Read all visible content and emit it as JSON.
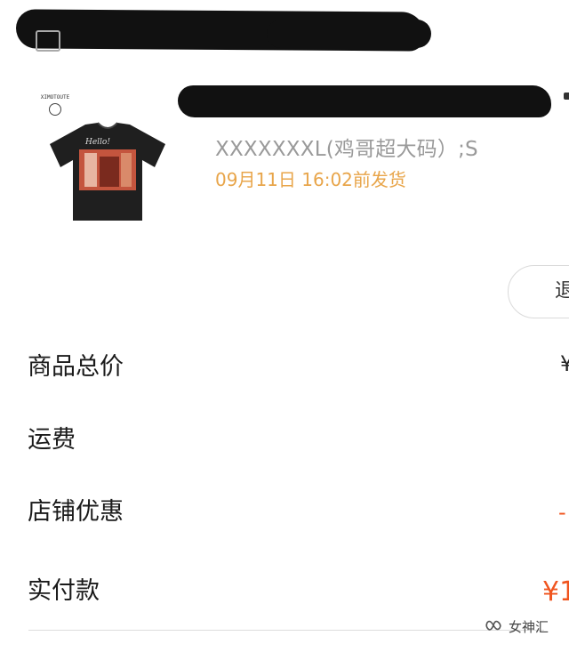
{
  "order": {
    "product": {
      "brand_logo": "XIMOTOUTE",
      "shirt_text": "Hello!",
      "spec": "XXXXXXXL(鸡哥超大码）;S",
      "ship_time": "09月11日 16:02前发货"
    },
    "action_button": {
      "label": "退"
    },
    "summary": {
      "total_label": "商品总价",
      "total_value": "¥",
      "shipping_label": "运费",
      "discount_label": "店铺优惠",
      "discount_value": "-",
      "paid_label": "实付款",
      "paid_value": "¥1"
    }
  },
  "watermark": {
    "text": "女神汇",
    "icon": "wechat-channel-icon"
  },
  "colors": {
    "ship_time": "#e8a54a",
    "price_accent": "#f0541e",
    "spec_gray": "#9a9a9a"
  }
}
